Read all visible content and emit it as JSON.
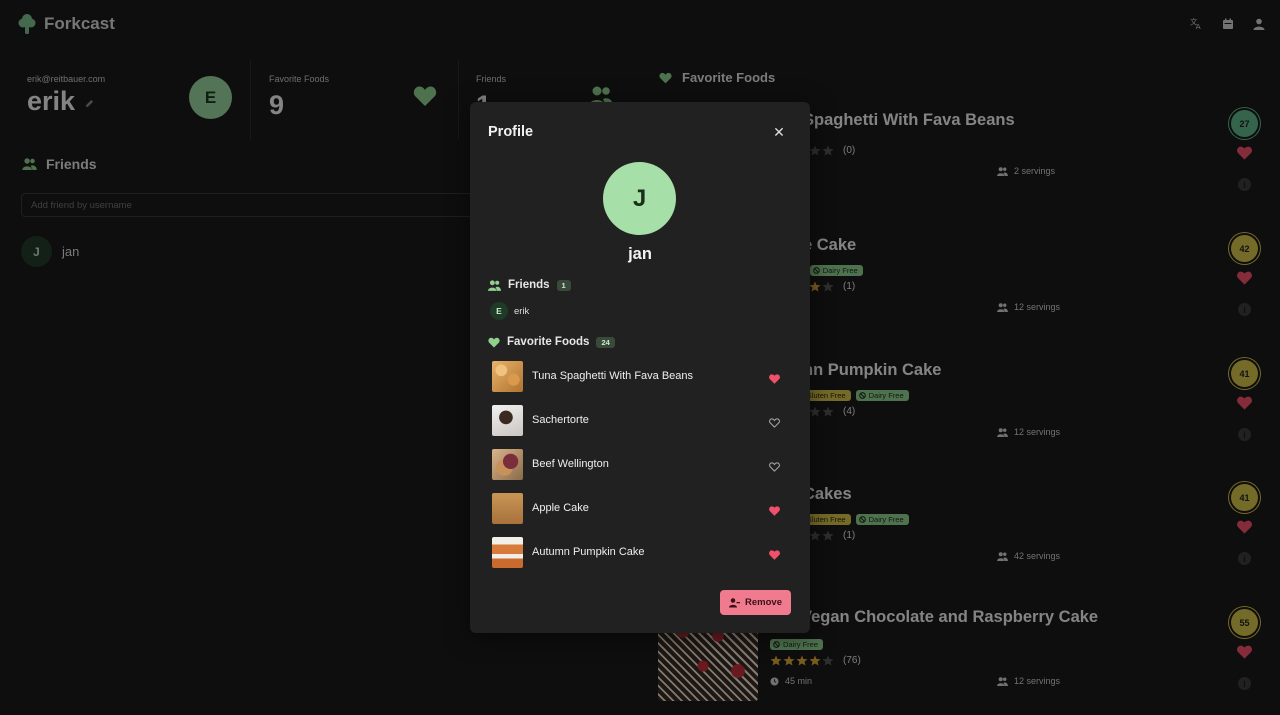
{
  "app": {
    "title": "Forkcast"
  },
  "header": {
    "icons": [
      "translate-icon",
      "calendar-icon",
      "account-icon"
    ]
  },
  "profile_stats": {
    "email": "erik@reitbauer.com",
    "username": "erik",
    "avatar_letter": "E",
    "favorite_foods_label": "Favorite Foods",
    "favorite_foods_count": "9",
    "friends_label": "Friends",
    "friends_count": "1"
  },
  "friends_panel": {
    "heading": "Friends",
    "add_placeholder": "Add friend by username",
    "friends": [
      {
        "letter": "J",
        "name": "jan"
      }
    ]
  },
  "favorite_foods_panel": {
    "heading": "Favorite Foods",
    "items": [
      {
        "title": "Spaghetti With Fava Beans",
        "tags": [],
        "rating_count": "(0)",
        "stars": 1,
        "time": "n",
        "servings": "2 servings",
        "score": "27",
        "score_color": "#5fb88a",
        "favorited": true
      },
      {
        "title": "e Cake",
        "tags": [
          {
            "label": "arian",
            "style": "green"
          },
          {
            "label": "Dairy Free",
            "style": "green"
          }
        ],
        "rating_count": "(1)",
        "stars": 4,
        "time": "n",
        "servings": "12 servings",
        "score": "42",
        "score_color": "#d6c34a",
        "favorited": true
      },
      {
        "title": "nn Pumpkin Cake",
        "tags": [
          {
            "label": "",
            "style": "green"
          },
          {
            "label": "Gluten Free",
            "style": "yellow"
          },
          {
            "label": "Dairy Free",
            "style": "green"
          }
        ],
        "rating_count": "(4)",
        "stars": 3,
        "time": "n",
        "servings": "12 servings",
        "score": "41",
        "score_color": "#d6c34a",
        "favorited": true
      },
      {
        "title": "Cakes",
        "tags": [
          {
            "label": "",
            "style": "green"
          },
          {
            "label": "Gluten Free",
            "style": "yellow"
          },
          {
            "label": "Dairy Free",
            "style": "green"
          }
        ],
        "rating_count": "(1)",
        "stars": 3,
        "time": "n",
        "servings": "42 servings",
        "score": "41",
        "score_color": "#d6c34a",
        "favorited": true
      },
      {
        "title": "Vegan Chocolate and Raspberry Cake",
        "tags": [
          {
            "label": "Dairy Free",
            "style": "green"
          }
        ],
        "rating_count": "(76)",
        "stars": 4,
        "time": "45 min",
        "servings": "12 servings",
        "score": "55",
        "score_color": "#d6c34a",
        "favorited": true
      }
    ]
  },
  "modal": {
    "title": "Profile",
    "avatar_letter": "J",
    "username": "jan",
    "friends_heading": "Friends",
    "friends_count": "1",
    "friends": [
      {
        "letter": "E",
        "name": "erik"
      }
    ],
    "favorites_heading": "Favorite Foods",
    "favorites_count": "24",
    "favorites": [
      {
        "name": "Tuna Spaghetti With Fava Beans",
        "favorited": true
      },
      {
        "name": "Sachertorte",
        "favorited": false
      },
      {
        "name": "Beef Wellington",
        "favorited": false
      },
      {
        "name": "Apple Cake",
        "favorited": true
      },
      {
        "name": "Autumn Pumpkin Cake",
        "favorited": true
      }
    ],
    "remove_label": "Remove"
  },
  "colors": {
    "accent_green": "#9ad39e",
    "heart_red": "#f0506a",
    "star_gold": "#e0a83a",
    "remove_pink": "#f07a8e"
  }
}
